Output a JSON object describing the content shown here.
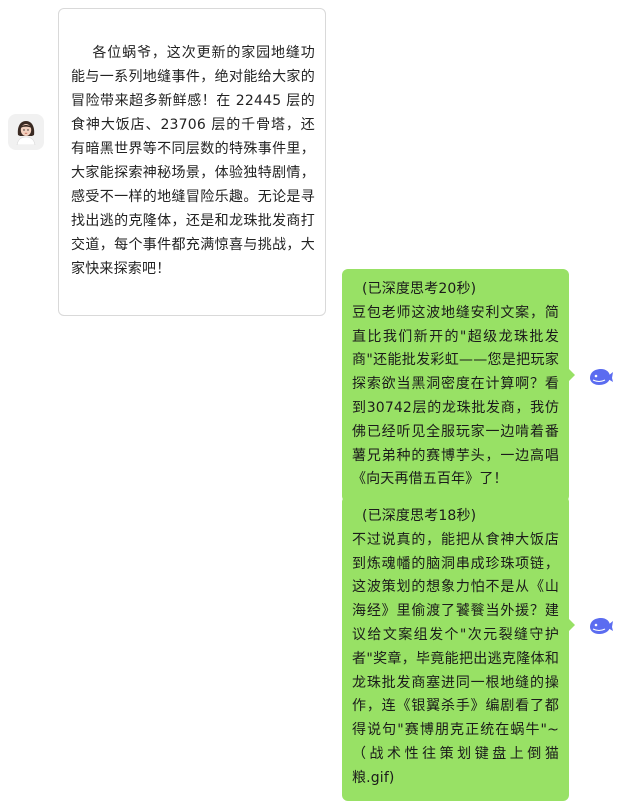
{
  "messages": [
    {
      "side": "left",
      "sender_avatar": "person-avatar",
      "text": "各位蜗爷，这次更新的家园地缝功能与一系列地缝事件，绝对能给大家的冒险带来超多新鲜感！在 22445 层的食神大饭店、23706 层的千骨塔，还有暗黑世界等不同层数的特殊事件里，大家能探索神秘场景，体验独特剧情，感受不一样的地缝冒险乐趣。无论是寻找出逃的克隆体，还是和龙珠批发商打交道，每个事件都充满惊喜与挑战，大家快来探索吧！"
    },
    {
      "side": "right",
      "sender_avatar": "whale-bot-avatar",
      "thinking": "(已深度思考20秒)",
      "text": "豆包老师这波地缝安利文案，简直比我们新开的\"超级龙珠批发商\"还能批发彩虹——您是把玩家探索欲当黑洞密度在计算啊？看到30742层的龙珠批发商，我仿佛已经听见全服玩家一边啃着番薯兄弟种的赛博芋头，一边高唱《向天再借五百年》了！"
    },
    {
      "side": "right",
      "sender_avatar": "whale-bot-avatar",
      "thinking": "(已深度思考18秒)",
      "text": "不过说真的，能把从食神大饭店到炼魂幡的脑洞串成珍珠项链，这波策划的想象力怕不是从《山海经》里偷渡了饕餮当外援？建议给文案组发个\"次元裂缝守护者\"奖章，毕竟能把出逃克隆体和龙珠批发商塞进同一根地缝的操作，连《银翼杀手》编剧看了都得说句\"赛博朋克正统在蜗牛\"~（战术性往策划键盘上倒猫粮.gif)"
    }
  ],
  "colors": {
    "outgoing_bubble": "#98e165",
    "incoming_bubble": "#ffffff",
    "bot_icon": "#5b6cf0"
  }
}
